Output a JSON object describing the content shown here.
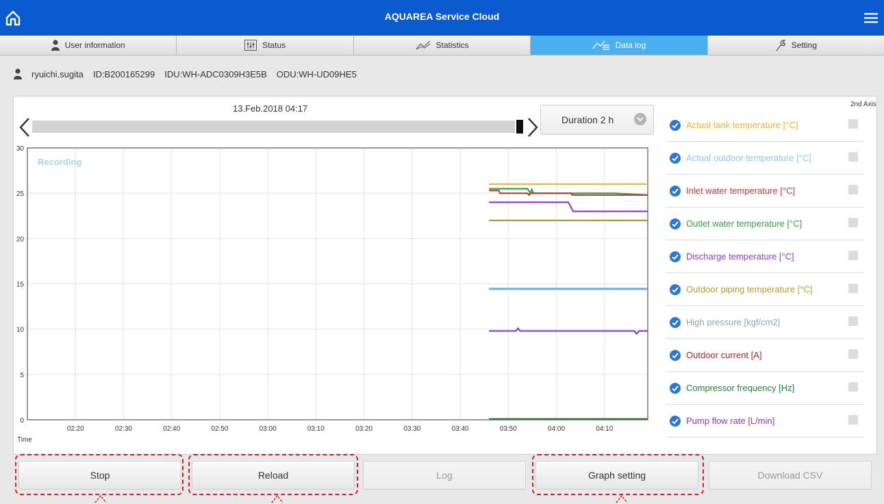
{
  "app": {
    "title": "AQUAREA Service Cloud"
  },
  "tabs": [
    {
      "label": "User information",
      "icon": "person-icon"
    },
    {
      "label": "Status",
      "icon": "status-icon"
    },
    {
      "label": "Statistics",
      "icon": "statistics-icon"
    },
    {
      "label": "Data log",
      "icon": "data-log-icon",
      "active": true
    },
    {
      "label": "Setting",
      "icon": "wrench-icon"
    }
  ],
  "user": {
    "name": "ryuichi.sugita",
    "id": "ID:B200165299",
    "idu": "IDU:WH-ADC0309H3E5B",
    "odu": "ODU:WH-UD09HE5"
  },
  "datetime": "13.Feb.2018 04:17",
  "duration": {
    "label": "Duration 2 h"
  },
  "second_axis_label": "2nd Axis",
  "legend": [
    {
      "label": "Actual tank temperature [°C]",
      "color": "#f0b43c"
    },
    {
      "label": "Actual outdoor temperature [°C]",
      "color": "#8ec8ef"
    },
    {
      "label": "Inlet water temperature [°C]",
      "color": "#c0393b"
    },
    {
      "label": "Outlet water temperature [°C]",
      "color": "#3e9a4c"
    },
    {
      "label": "Discharge temperature [°C]",
      "color": "#8b3fd6"
    },
    {
      "label": "Outdoor piping temperature [°C]",
      "color": "#b59a3c"
    },
    {
      "label": "High pressure [kgf/cm2]",
      "color": "#8aa6c8"
    },
    {
      "label": "Outdoor current [A]",
      "color": "#9b2c2c"
    },
    {
      "label": "Compressor frequency [Hz]",
      "color": "#2f7a3a"
    },
    {
      "label": "Pump flow rate [L/min]",
      "color": "#7a3fc8"
    }
  ],
  "buttons": {
    "stop": "Stop",
    "reload": "Reload",
    "log": "Log",
    "graph_setting": "Graph setting",
    "download_csv": "Download CSV"
  },
  "chart_data": {
    "type": "line",
    "recording_label": "Recording",
    "xlabel": "Time",
    "x_ticks": [
      "02:20",
      "02:30",
      "02:40",
      "02:50",
      "03:00",
      "03:10",
      "03:20",
      "03:30",
      "03:40",
      "03:50",
      "04:00",
      "04:10"
    ],
    "y_ticks": [
      0,
      5,
      10,
      15,
      20,
      25,
      30
    ],
    "ylim": [
      0,
      30
    ],
    "xlim_minutes": [
      2.25,
      4.3167
    ],
    "x_unit": "hours (02:15 = 2.25)",
    "grid": true,
    "series": [
      {
        "name": "Actual tank temperature [°C]",
        "color": "#f0b43c",
        "points": [
          [
            3.7667,
            26.0
          ],
          [
            4.3167,
            26.0
          ]
        ]
      },
      {
        "name": "Outlet water temperature [°C]",
        "color": "#3e9a4c",
        "points": [
          [
            3.7667,
            25.5
          ],
          [
            3.9,
            25.5
          ],
          [
            3.91,
            25.0
          ],
          [
            3.915,
            25.4
          ],
          [
            3.92,
            25.0
          ],
          [
            4.2,
            25.0
          ],
          [
            4.3167,
            24.8
          ]
        ]
      },
      {
        "name": "Inlet water temperature [°C]",
        "color": "#c0393b",
        "points": [
          [
            3.7667,
            25.3
          ],
          [
            3.8,
            25.3
          ],
          [
            3.805,
            25.0
          ],
          [
            3.9,
            25.0
          ],
          [
            3.905,
            24.8
          ],
          [
            3.91,
            25.0
          ],
          [
            4.05,
            25.0
          ],
          [
            4.055,
            24.8
          ],
          [
            4.3167,
            24.8
          ]
        ]
      },
      {
        "name": "Discharge temperature [°C]",
        "color": "#8b3fd6",
        "points": [
          [
            3.7667,
            24.0
          ],
          [
            4.0417,
            24.0
          ],
          [
            4.0583,
            23.0
          ],
          [
            4.3167,
            23.0
          ]
        ]
      },
      {
        "name": "Outdoor piping temperature [°C]",
        "color": "#b59a3c",
        "points": [
          [
            3.7667,
            22.0
          ],
          [
            4.3167,
            22.0
          ]
        ]
      },
      {
        "name": "Actual outdoor temperature [°C]",
        "color": "#8ec8ef",
        "points": [
          [
            3.7667,
            14.5
          ],
          [
            4.3167,
            14.5
          ]
        ]
      },
      {
        "name": "High pressure [kgf/cm2]",
        "color": "#8aa6c8",
        "points": [
          [
            3.7667,
            14.4
          ],
          [
            4.3167,
            14.4
          ]
        ]
      },
      {
        "name": "Pump flow rate [L/min]",
        "color": "#7a3fc8",
        "points": [
          [
            3.7667,
            9.8
          ],
          [
            3.86,
            9.8
          ],
          [
            3.867,
            10.1
          ],
          [
            3.874,
            9.8
          ],
          [
            4.27,
            9.8
          ],
          [
            4.278,
            9.5
          ],
          [
            4.286,
            9.8
          ],
          [
            4.3167,
            9.8
          ]
        ]
      },
      {
        "name": "Compressor frequency [Hz]",
        "color": "#2f7a3a",
        "points": [
          [
            3.7667,
            0.1
          ],
          [
            4.3167,
            0.1
          ]
        ]
      }
    ]
  }
}
